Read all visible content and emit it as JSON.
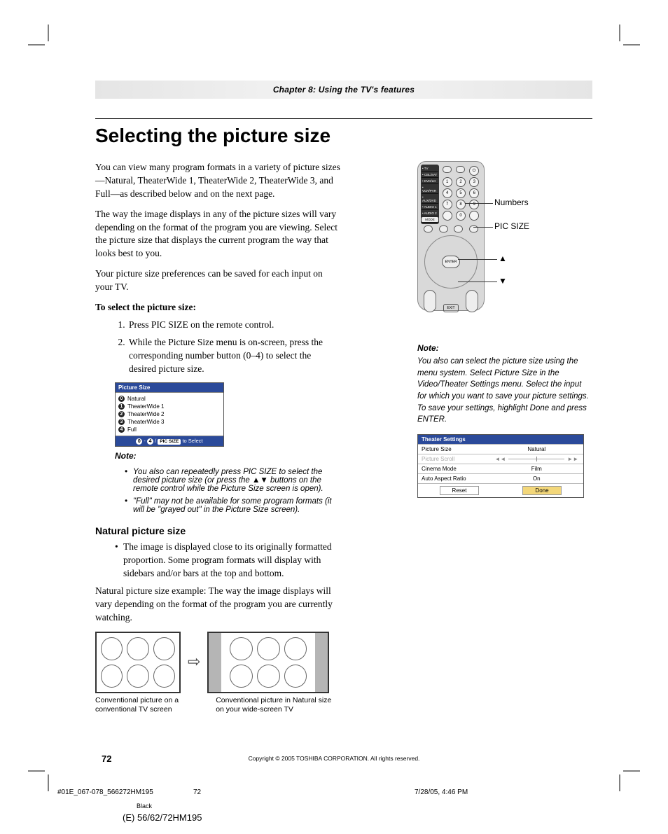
{
  "chapter": "Chapter 8: Using the TV's features",
  "title": "Selecting the picture size",
  "p1": "You can view many program formats in a variety of picture sizes—Natural, TheaterWide 1, TheaterWide 2, TheaterWide 3, and Full—as described below and on the next page.",
  "p2": "The way the image displays in any of the picture sizes will vary depending on the format of the program you are viewing. Select the picture size that displays the current program the way that looks best to you.",
  "p3": "Your picture size preferences can be saved for each input on your TV.",
  "procHead": "To select the picture size:",
  "proc": [
    "Press PIC SIZE on the remote control.",
    "While the Picture Size menu is on-screen, press the corresponding number button (0–4) to select the desired picture size."
  ],
  "psMenu": {
    "title": "Picture Size",
    "items": [
      {
        "n": "0",
        "label": "Natural"
      },
      {
        "n": "1",
        "label": "TheaterWide 1"
      },
      {
        "n": "2",
        "label": "TheaterWide 2"
      },
      {
        "n": "3",
        "label": "TheaterWide 3"
      },
      {
        "n": "4",
        "label": "Full"
      }
    ],
    "footPill": "PIC SIZE",
    "footTail": " to Select"
  },
  "noteL": {
    "head": "Note:",
    "items": [
      "You also can repeatedly press PIC SIZE to select the desired picture size (or press the ▲▼ buttons on the remote control while the Picture Size screen is open).",
      "\"Full\" may not be available for some program formats (it will be \"grayed out\" in the Picture Size screen)."
    ]
  },
  "sec2": {
    "title": "Natural picture size",
    "bullet": "The image is displayed close to its originally formatted proportion. Some program formats will display with sidebars and/or bars at the top and bottom.",
    "p": "Natural picture size example: The way the image displays will vary depending on the format of the program you are currently watching.",
    "cap1": "Conventional picture on a conventional TV screen",
    "cap2": "Conventional picture in Natural size on your wide-screen TV"
  },
  "callouts": {
    "numbers": "Numbers",
    "picsize": "PIC SIZE",
    "up": "▲",
    "down": "▼"
  },
  "remoteLabels": [
    "• TV",
    "• CBL/SAT",
    "• DVD/LD",
    "• VCR/PVR",
    "• AUX/DVD",
    "• AUDIO 1",
    "• AUDIO 2"
  ],
  "remoteMode": "MODE",
  "remoteEnter": "ENTER",
  "remoteExit": "EXIT",
  "noteR": {
    "head": "Note:",
    "p": "You also can select the picture size using the menu system. Select Picture Size in the Video/Theater Settings menu. Select the input for which you want to save your picture settings.  To save your settings, highlight Done and press ENTER."
  },
  "ts": {
    "title": "Theater Settings",
    "rows": [
      {
        "k": "Picture Size",
        "v": "Natural",
        "dim": false
      },
      {
        "k": "Picture Scroll",
        "v": "slider",
        "dim": true
      },
      {
        "k": "Cinema Mode",
        "v": "Film",
        "dim": false
      },
      {
        "k": "Auto Aspect Ratio",
        "v": "On",
        "dim": false
      }
    ],
    "reset": "Reset",
    "done": "Done"
  },
  "page": "72",
  "copyright": "Copyright © 2005 TOSHIBA CORPORATION. All rights reserved.",
  "foot": {
    "left": "#01E_067-078_566272HM195",
    "mid": "72",
    "right": "7/28/05, 4:46 PM"
  },
  "black": "Black",
  "model": "(E) 56/62/72HM195"
}
